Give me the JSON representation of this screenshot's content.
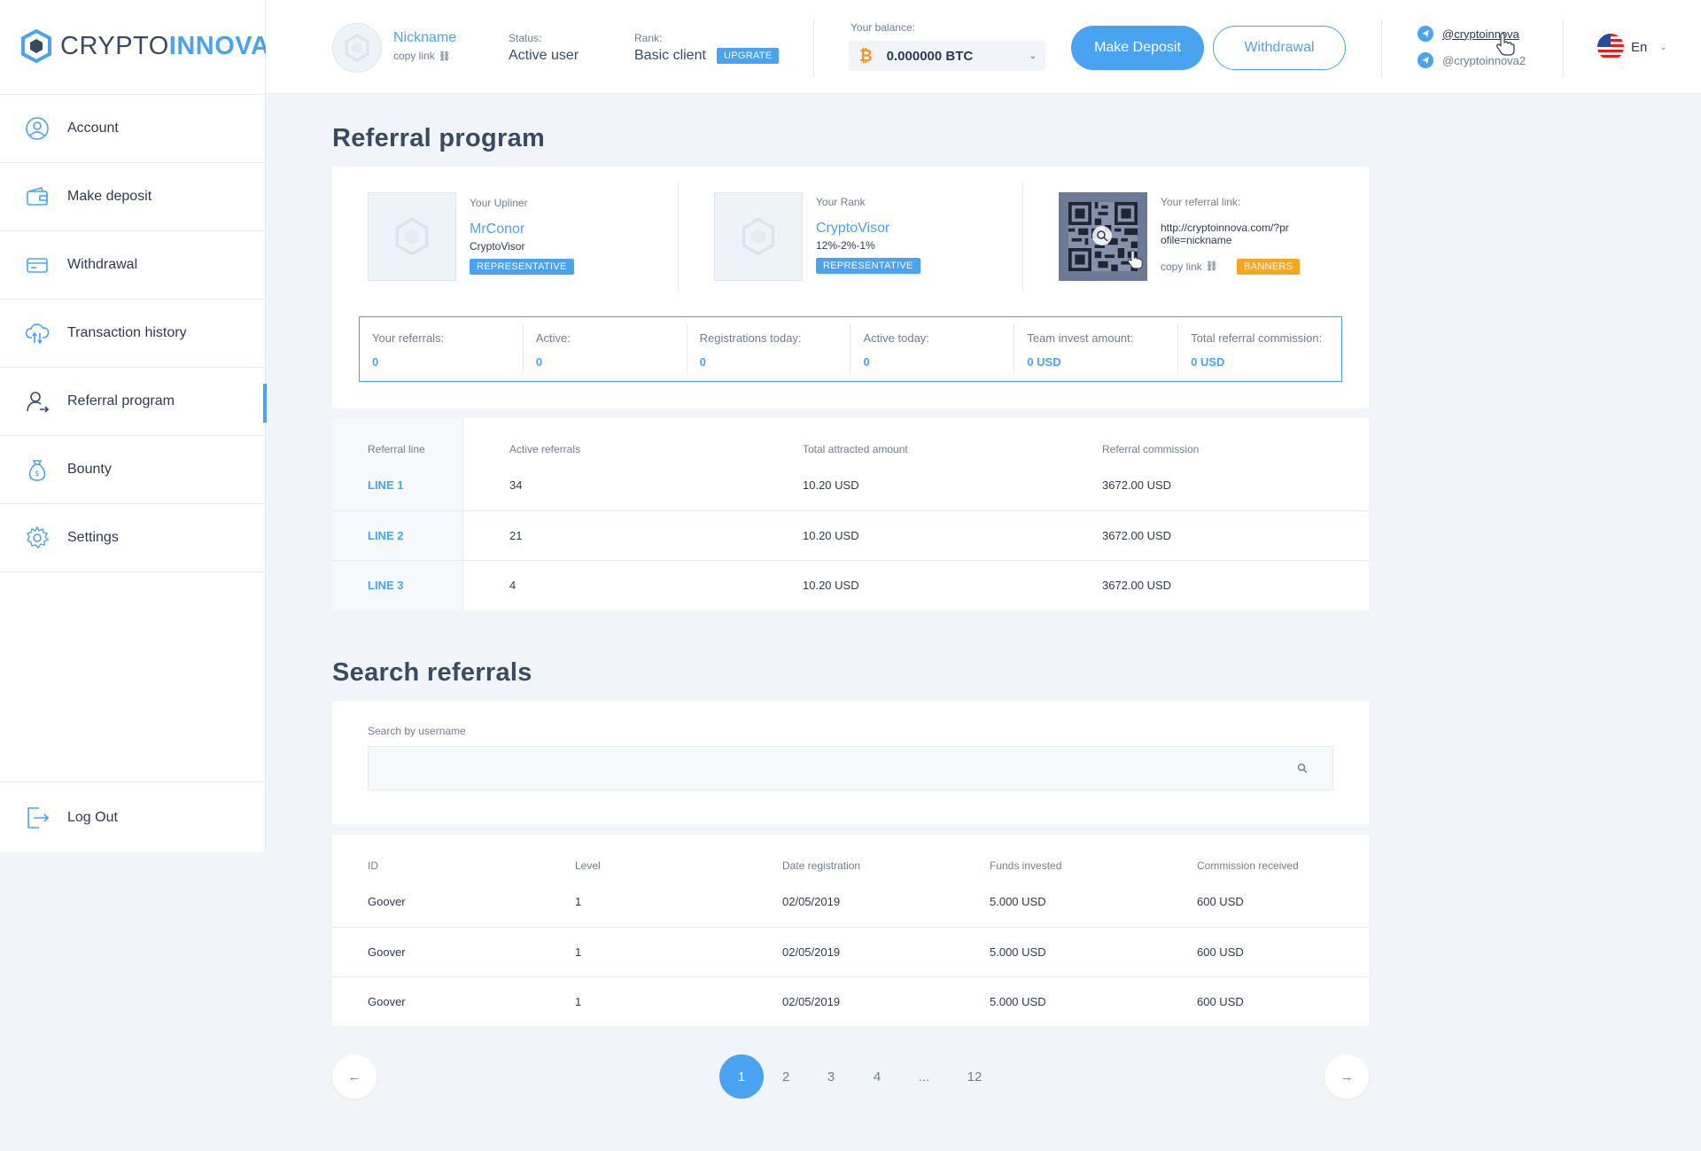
{
  "brand": {
    "prefix": "CRYPTO",
    "suffix": "INNOVA"
  },
  "sidebar": {
    "items": [
      {
        "label": "Account"
      },
      {
        "label": "Make deposit"
      },
      {
        "label": "Withdrawal"
      },
      {
        "label": "Transaction history"
      },
      {
        "label": "Referral program"
      },
      {
        "label": "Bounty"
      },
      {
        "label": "Settings"
      }
    ],
    "logout": "Log Out"
  },
  "header": {
    "nickname": "Nickname",
    "copy_link": "copy link",
    "status_label": "Status:",
    "status_value": "Active user",
    "rank_label": "Rank:",
    "rank_value": "Basic client",
    "upgrade": "UPGRATE",
    "balance_label": "Your balance:",
    "balance_value": "0.000000 BTC",
    "make_deposit": "Make Deposit",
    "withdrawal": "Withdrawal",
    "telegram1": "@cryptoinnova",
    "telegram2": "@cryptoinnova2",
    "language": "En"
  },
  "referral": {
    "title": "Referral program",
    "upliner_label": "Your Upliner",
    "upliner_name": "MrConor",
    "upliner_rank": "CryptoVisor",
    "upliner_badge": "REPRESENTATIVE",
    "rank_label": "Your Rank",
    "rank_name": "CryptoVisor",
    "rank_percent": "12%-2%-1%",
    "rank_badge": "REPRESENTATIVE",
    "link_label": "Your referral link:",
    "link_line1": "http://cryptoinnova.com/?pr",
    "link_line2": "ofile=nickname",
    "copy_link": "copy link",
    "banners": "BANNERS",
    "stats": [
      {
        "label": "Your referrals:",
        "value": "0"
      },
      {
        "label": "Active:",
        "value": "0"
      },
      {
        "label": "Registrations today:",
        "value": "0"
      },
      {
        "label": "Active today:",
        "value": "0"
      },
      {
        "label": "Team invest amount:",
        "value": "0 USD"
      },
      {
        "label": "Total referral commission:",
        "value": "0 USD"
      }
    ]
  },
  "lines_table": {
    "headers": [
      "Referral line",
      "Active referrals",
      "Total attracted amount",
      "Referral commission"
    ],
    "rows": [
      {
        "line": "LINE 1",
        "active": "34",
        "amount": "10.20 USD",
        "commission": "3672.00 USD"
      },
      {
        "line": "LINE 2",
        "active": "21",
        "amount": "10.20 USD",
        "commission": "3672.00 USD"
      },
      {
        "line": "LINE 3",
        "active": "4",
        "amount": "10.20 USD",
        "commission": "3672.00 USD"
      }
    ]
  },
  "search": {
    "title": "Search referrals",
    "label": "Search by username",
    "placeholder": ""
  },
  "referrals_table": {
    "headers": [
      "ID",
      "Level",
      "Date registration",
      "Funds invested",
      "Commission received"
    ],
    "rows": [
      {
        "id": "Goover",
        "level": "1",
        "date": "02/05/2019",
        "funds": "5.000 USD",
        "commission": "600 USD"
      },
      {
        "id": "Goover",
        "level": "1",
        "date": "02/05/2019",
        "funds": "5.000 USD",
        "commission": "600 USD"
      },
      {
        "id": "Goover",
        "level": "1",
        "date": "02/05/2019",
        "funds": "5.000 USD",
        "commission": "600 USD"
      }
    ]
  },
  "pagination": {
    "pages": [
      "1",
      "2",
      "3",
      "4",
      "...",
      "12"
    ],
    "current": "1",
    "prev": "←",
    "next": "→"
  },
  "colors": {
    "accent": "#4aa3f0",
    "orange": "#f5a623",
    "text": "#3b4a63",
    "bg": "#f1f5f9"
  }
}
